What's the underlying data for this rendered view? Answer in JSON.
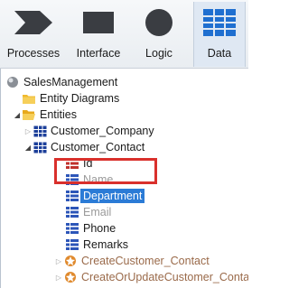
{
  "toolbar": {
    "processes_label": "Processes",
    "interface_label": "Interface",
    "logic_label": "Logic",
    "data_label": "Data",
    "active_tab": "Data"
  },
  "tree": {
    "root": "SalesManagement",
    "entity_diagrams": "Entity Diagrams",
    "entities": "Entities",
    "customer_company": "Customer_Company",
    "customer_contact": "Customer_Contact",
    "attributes": [
      "Id",
      "Name",
      "Department",
      "Email",
      "Phone",
      "Remarks"
    ],
    "selected_attribute": "Department",
    "actions": [
      "CreateCustomer_Contact",
      "CreateOrUpdateCustomer_Contact"
    ]
  },
  "colors": {
    "selection": "#2b7bd6",
    "highlight_box": "#d9302c",
    "folder": "#f0b92e",
    "entity_icon": "#1c3f9a"
  }
}
